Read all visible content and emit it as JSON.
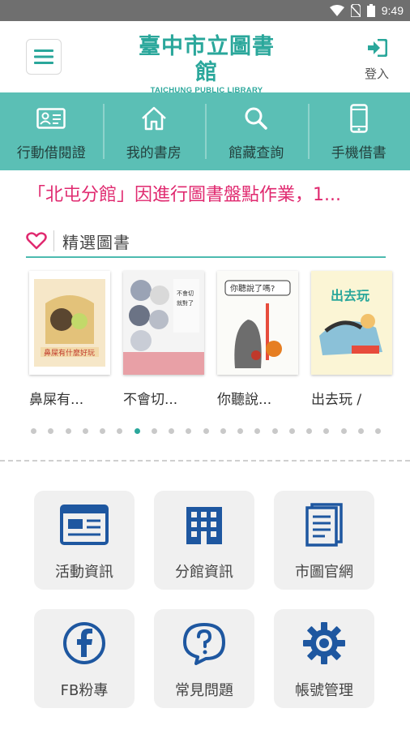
{
  "status_bar": {
    "time": "9:49"
  },
  "header": {
    "logo_title": "臺中市立圖書館",
    "logo_subtitle": "TAICHUNG PUBLIC LIBRARY",
    "login_label": "登入"
  },
  "nav": {
    "items": [
      {
        "label": "行動借閱證",
        "icon": "library-card-icon"
      },
      {
        "label": "我的書房",
        "icon": "home-icon"
      },
      {
        "label": "館藏查詢",
        "icon": "search-icon"
      },
      {
        "label": "手機借書",
        "icon": "phone-icon"
      }
    ]
  },
  "notice": {
    "text": "「北屯分館」因進行圖書盤點作業，1..."
  },
  "featured": {
    "title": "精選圖書",
    "books": [
      {
        "title": "鼻屎有..."
      },
      {
        "title": "不會切..."
      },
      {
        "title": "你聽說..."
      },
      {
        "title": "出去玩 /"
      }
    ],
    "dot_count": 21,
    "active_dot": 6
  },
  "tiles": [
    {
      "label": "活動資訊",
      "icon": "newspaper-icon"
    },
    {
      "label": "分館資訊",
      "icon": "building-icon"
    },
    {
      "label": "市圖官網",
      "icon": "document-icon"
    },
    {
      "label": "FB粉專",
      "icon": "facebook-icon"
    },
    {
      "label": "常見問題",
      "icon": "question-bubble-icon"
    },
    {
      "label": "帳號管理",
      "icon": "gear-icon"
    }
  ],
  "colors": {
    "accent": "#5bbfb5",
    "brand": "#2aa79b",
    "notice": "#e0296f",
    "tile_icon": "#1e57a0"
  }
}
